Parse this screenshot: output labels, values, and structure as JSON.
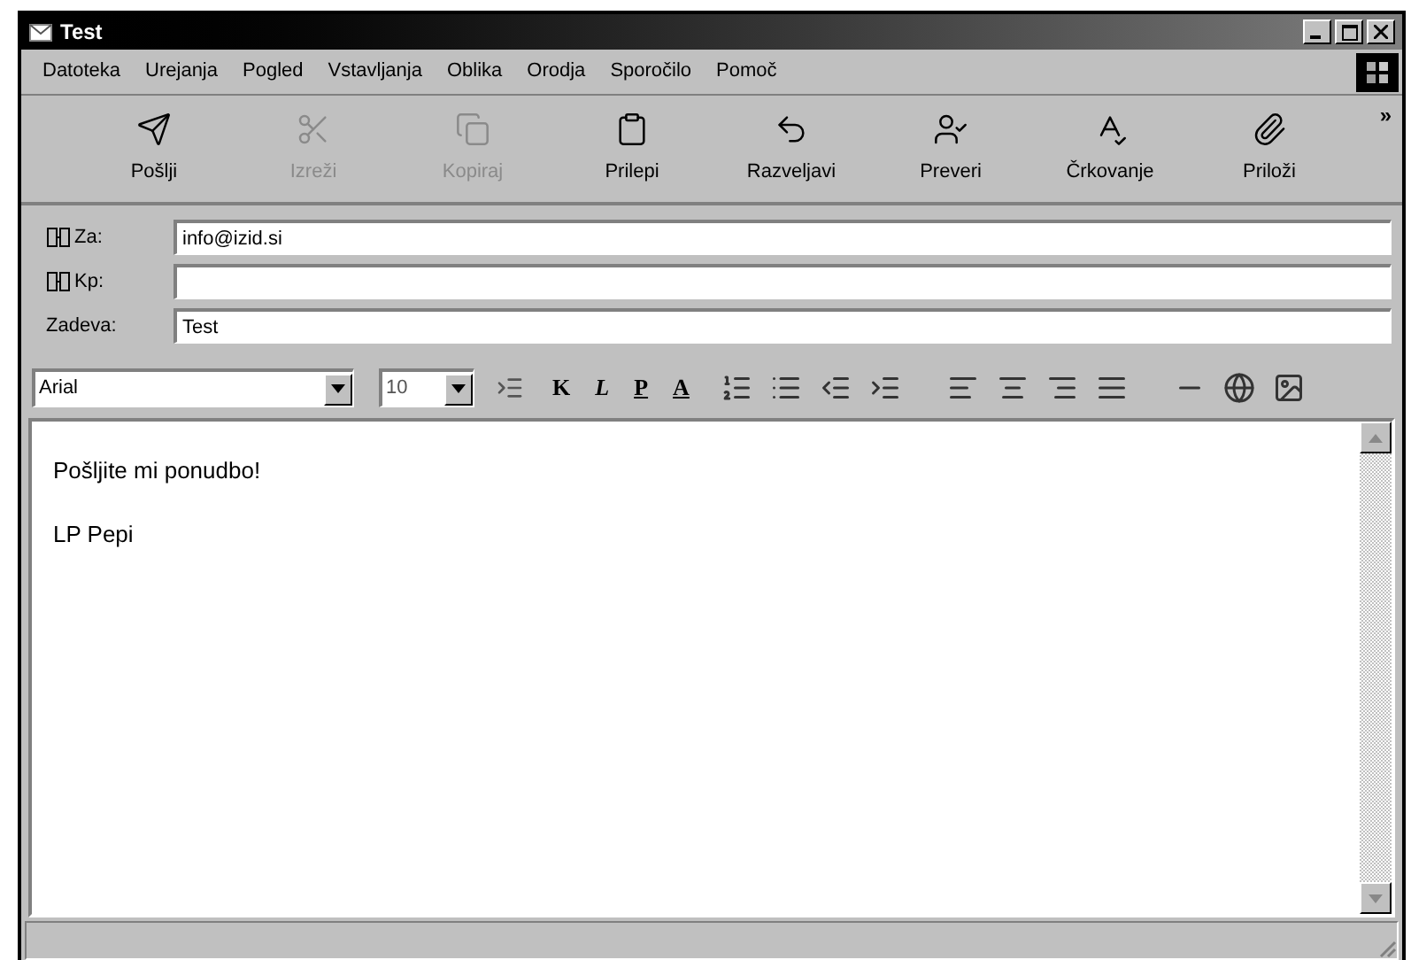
{
  "window": {
    "title": "Test"
  },
  "menu": [
    {
      "label": "Datoteka"
    },
    {
      "label": "Urejanja"
    },
    {
      "label": "Pogled"
    },
    {
      "label": "Vstavljanja"
    },
    {
      "label": "Oblika"
    },
    {
      "label": "Orodja"
    },
    {
      "label": "Sporočilo"
    },
    {
      "label": "Pomoč"
    }
  ],
  "toolbar": [
    {
      "label": "Pošlji",
      "kind": "send",
      "disabled": false
    },
    {
      "label": "Izreži",
      "kind": "cut",
      "disabled": true
    },
    {
      "label": "Kopiraj",
      "kind": "copy",
      "disabled": true
    },
    {
      "label": "Prilepi",
      "kind": "paste",
      "disabled": false
    },
    {
      "label": "Razveljavi",
      "kind": "undo",
      "disabled": false
    },
    {
      "label": "Preveri",
      "kind": "check",
      "disabled": false
    },
    {
      "label": "Črkovanje",
      "kind": "spell",
      "disabled": false
    },
    {
      "label": "Priloži",
      "kind": "attach",
      "disabled": false
    }
  ],
  "toolbar_more": "»",
  "fields": [
    {
      "label": "Za:",
      "book": true,
      "value": "info@izid.si"
    },
    {
      "label": "Kp:",
      "book": true
    },
    {
      "label": "Zadeva:",
      "book": false,
      "value": "Test"
    }
  ],
  "format_bar": {
    "font": "Arial",
    "size": "10",
    "style_buttons": [
      "K",
      "L",
      "P",
      "A"
    ]
  },
  "body": {
    "lines": [
      "Pošljite mi ponudbo!",
      "LP Pepi"
    ]
  }
}
